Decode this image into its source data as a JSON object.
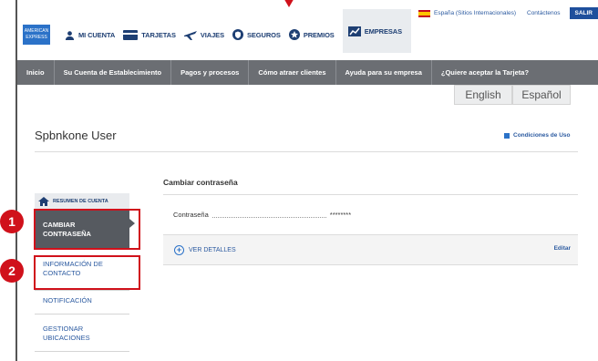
{
  "header": {
    "nav": [
      {
        "label": "MI CUENTA",
        "icon": "person-icon"
      },
      {
        "label": "TARJETAS",
        "icon": "card-icon"
      },
      {
        "label": "VIAJES",
        "icon": "plane-icon"
      },
      {
        "label": "SEGUROS",
        "icon": "shield-icon"
      },
      {
        "label": "PREMIOS",
        "icon": "gift-icon"
      },
      {
        "label": "EMPRESAS",
        "icon": "chart-icon"
      }
    ],
    "region": "España",
    "region_note": "(Sitios Internacionales)",
    "contact": "Contáctenos",
    "logout": "SALIR"
  },
  "menu": [
    "Inicio",
    "Su Cuenta de Establecimiento",
    "Pagos y procesos",
    "Cómo atraer clientes",
    "Ayuda para su empresa",
    "¿Quiere aceptar la Tarjeta?"
  ],
  "languages": [
    "English",
    "Español"
  ],
  "account": {
    "user": "Spbnkone User",
    "terms": "Condiciones de Uso"
  },
  "sidebar": {
    "summary": "RESUMEN DE CUENTA",
    "items": [
      {
        "line1": "CAMBIAR",
        "line2": "CONTRASEÑA"
      },
      {
        "line1": "INFORMACIÓN DE",
        "line2": "CONTACTO"
      },
      {
        "line1": "NOTIFICACIÓN",
        "line2": ""
      },
      {
        "line1": "GESTIONAR",
        "line2": "UBICACIONES"
      }
    ]
  },
  "main": {
    "title": "Cambiar contraseña",
    "password_label": "Contraseña",
    "password_value": "********",
    "details_link": "VER DETALLES",
    "edit_link": "Editar"
  },
  "annotations": [
    "1",
    "2"
  ],
  "colors": {
    "accent": "#d0111b",
    "brand": "#2b72c8",
    "menu": "#6b6e73"
  }
}
